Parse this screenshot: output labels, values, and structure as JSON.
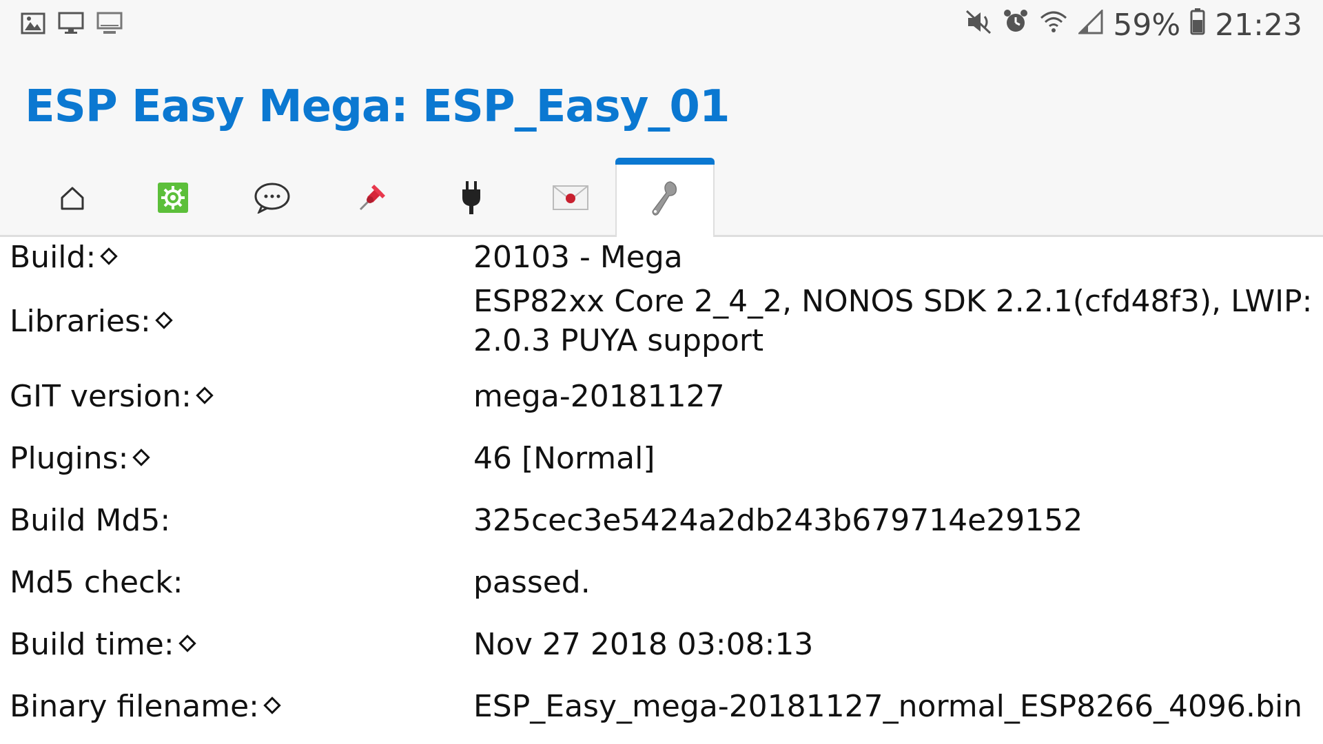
{
  "statusbar": {
    "left_icons": [
      "image-icon",
      "monitor-icon",
      "desktop-icon"
    ],
    "right_icons": [
      "mute-icon",
      "alarm-icon",
      "wifi-icon",
      "signal-icon"
    ],
    "battery_percent": "59%",
    "time": "21:23"
  },
  "header": {
    "title": "ESP Easy Mega: ESP_Easy_01"
  },
  "tabs": [
    {
      "icon": "home-icon"
    },
    {
      "icon": "config-gear-icon"
    },
    {
      "icon": "chat-icon"
    },
    {
      "icon": "pushpin-icon"
    },
    {
      "icon": "plug-icon"
    },
    {
      "icon": "envelope-icon"
    },
    {
      "icon": "wrench-icon",
      "active": true
    }
  ],
  "info": {
    "rows": [
      {
        "label": "Build:",
        "value": "20103 - Mega"
      },
      {
        "label": "Libraries:",
        "value": "ESP82xx Core 2_4_2, NONOS SDK 2.2.1(cfd48f3), LWIP: 2.0.3 PUYA support"
      },
      {
        "label": "GIT version:",
        "value": "mega-20181127"
      },
      {
        "label": "Plugins:",
        "value": "46 [Normal]"
      },
      {
        "label": "Build Md5:",
        "value": "325cec3e5424a2db243b679714e29152"
      },
      {
        "label": "Md5 check:",
        "value": "passed."
      },
      {
        "label": "Build time:",
        "value": "Nov 27 2018 03:08:13"
      },
      {
        "label": "Binary filename:",
        "value": "ESP_Easy_mega-20181127_normal_ESP8266_4096.bin"
      }
    ]
  },
  "colors": {
    "accent": "#0b78d1",
    "background": "#f7f7f7"
  }
}
